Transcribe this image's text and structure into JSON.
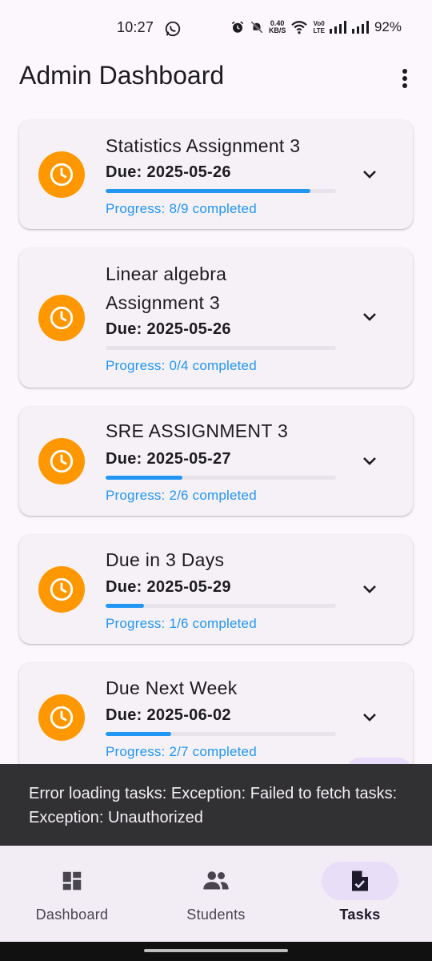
{
  "status_bar": {
    "time": "10:27",
    "network_speed_value": "0.40",
    "network_speed_unit": "KB/S",
    "volte_line1": "Vo0",
    "volte_line2": "LTE",
    "battery": "92%",
    "icons": [
      "whatsapp-icon",
      "alarm-icon",
      "mute-icon",
      "wifi-icon",
      "signal-icon",
      "signal-icon"
    ]
  },
  "app_bar": {
    "title": "Admin Dashboard",
    "menu_icon": "more-vert-icon"
  },
  "tasks": [
    {
      "title": "Statistics Assignment 3",
      "due": "Due: 2025-05-26",
      "progress": 0.889,
      "progress_text": "Progress: 8/9 completed"
    },
    {
      "title": "Linear algebra Assignment 3",
      "due": "Due: 2025-05-26",
      "progress": 0.0,
      "progress_text": "Progress: 0/4 completed"
    },
    {
      "title": "SRE ASSIGNMENT 3",
      "due": "Due: 2025-05-27",
      "progress": 0.333,
      "progress_text": "Progress: 2/6 completed"
    },
    {
      "title": "Due in 3 Days",
      "due": "Due: 2025-05-29",
      "progress": 0.167,
      "progress_text": "Progress: 1/6 completed"
    },
    {
      "title": "Due Next Week",
      "due": "Due: 2025-06-02",
      "progress": 0.286,
      "progress_text": "Progress: 2/7 completed"
    }
  ],
  "snackbar": {
    "message": "Error loading tasks: Exception: Failed to fetch tasks: Exception: Unauthorized"
  },
  "bottom_nav": {
    "items": [
      {
        "label": "Dashboard",
        "icon": "dashboard-icon",
        "active": false
      },
      {
        "label": "Students",
        "icon": "people-icon",
        "active": false
      },
      {
        "label": "Tasks",
        "icon": "task-icon",
        "active": true
      }
    ]
  },
  "colors": {
    "accent_orange": "#ff9800",
    "progress_blue": "#2196f3",
    "snackbar_bg": "#313033",
    "nav_active_pill": "#e8def8"
  }
}
